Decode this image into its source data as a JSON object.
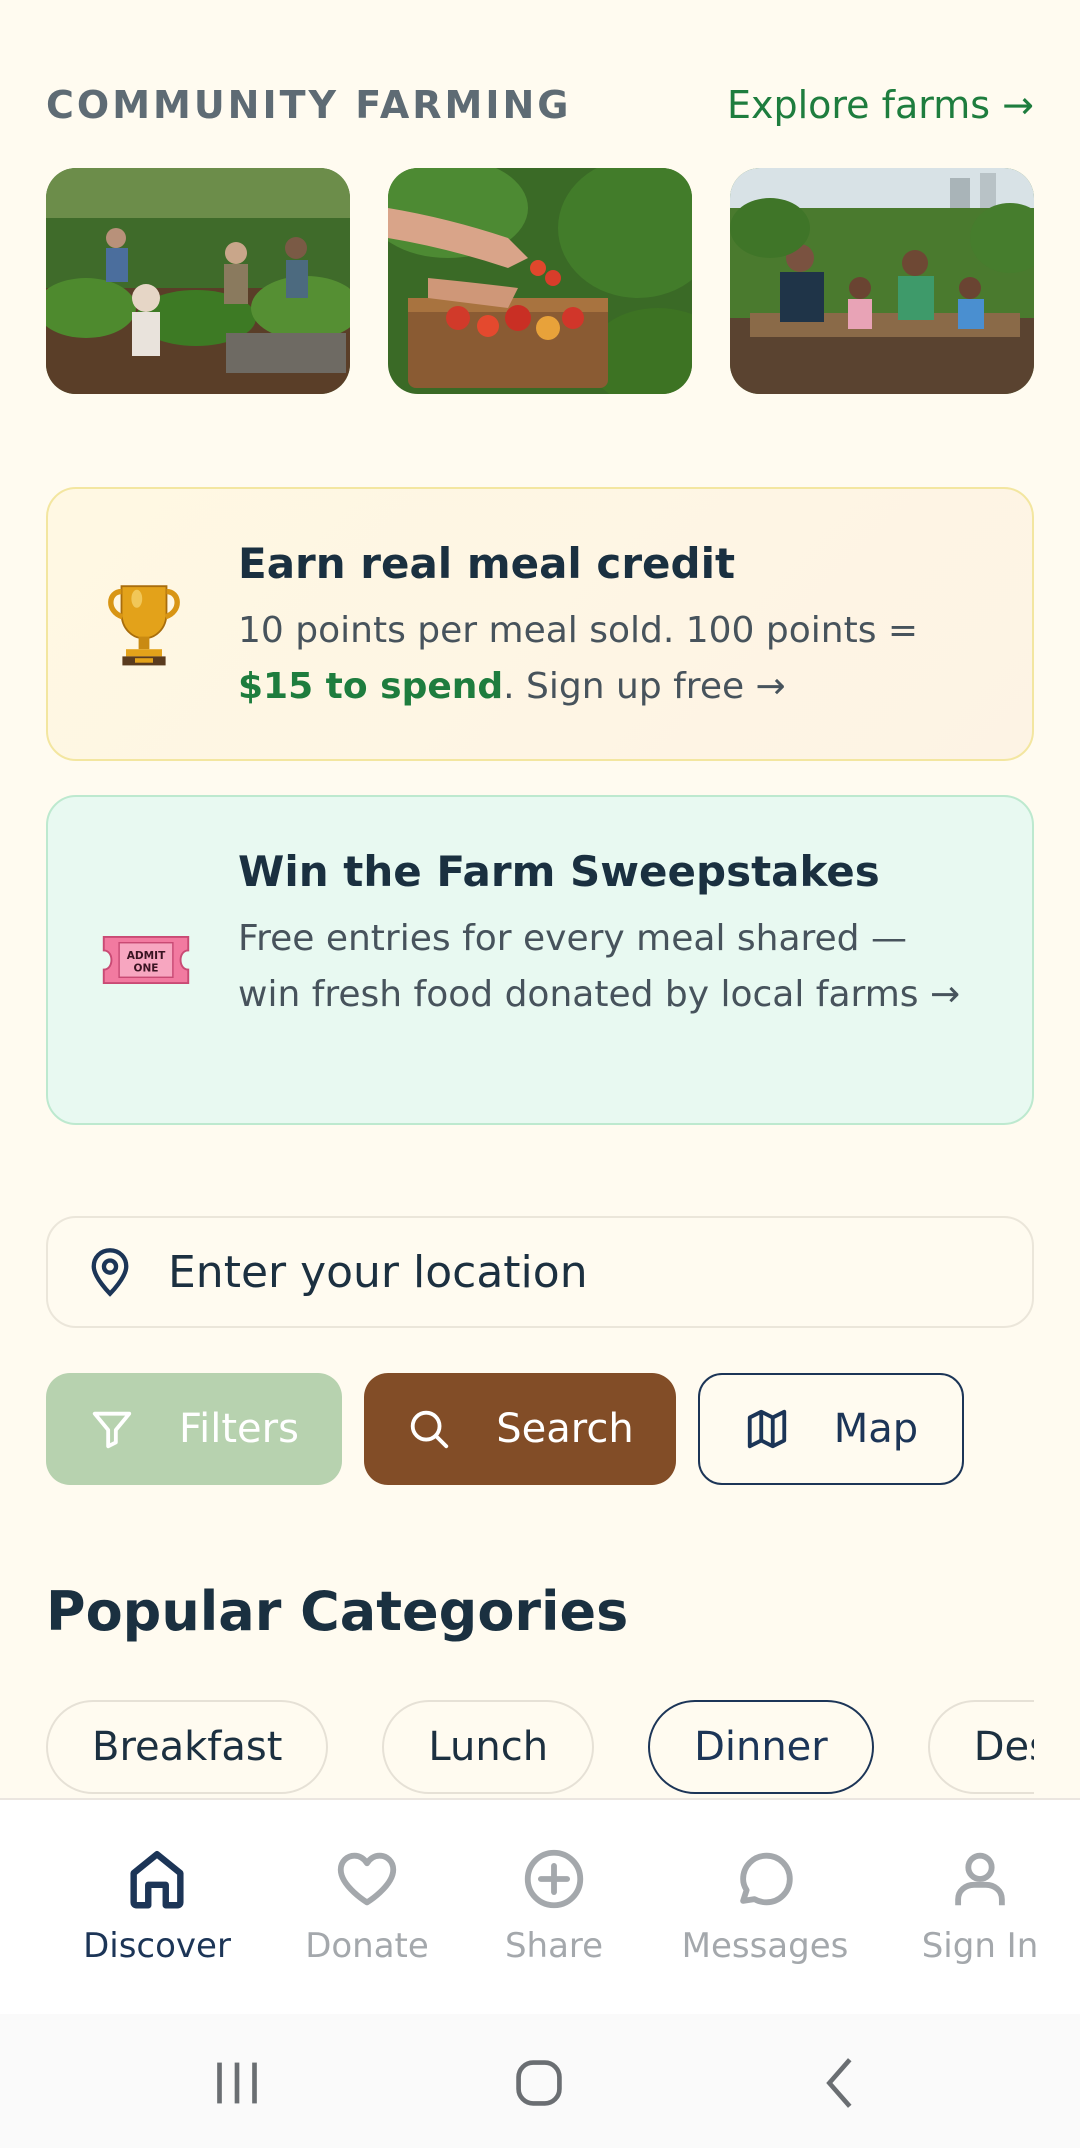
{
  "community": {
    "title": "COMMUNITY FARMING",
    "explore_link": "Explore farms →"
  },
  "promos": {
    "credit": {
      "icon": "trophy-icon",
      "title": "Earn real meal credit",
      "body_prefix": "10 points per meal sold. 100 points = ",
      "body_highlight": "$15 to spend",
      "body_suffix": ". Sign up free →"
    },
    "sweepstakes": {
      "icon": "admit-one-ticket-icon",
      "ticket_text_line1": "ADMIT",
      "ticket_text_line2": "ONE",
      "title": "Win the Farm Sweepstakes",
      "body": "Free entries for every meal shared — win fresh food donated by local farms →"
    }
  },
  "location": {
    "placeholder": "Enter your location",
    "icon": "map-pin-icon"
  },
  "actions": {
    "filters_label": "Filters",
    "search_label": "Search",
    "map_label": "Map"
  },
  "categories": {
    "title": "Popular Categories",
    "items": [
      "Breakfast",
      "Lunch",
      "Dinner",
      "Dessert"
    ],
    "active": "Dinner"
  },
  "nav": {
    "items": [
      {
        "label": "Discover",
        "icon": "home-icon",
        "active": true
      },
      {
        "label": "Donate",
        "icon": "heart-icon",
        "active": false
      },
      {
        "label": "Share",
        "icon": "plus-circle-icon",
        "active": false
      },
      {
        "label": "Messages",
        "icon": "message-bubble-icon",
        "active": false
      },
      {
        "label": "Sign In",
        "icon": "user-icon",
        "active": false
      }
    ]
  },
  "colors": {
    "background": "#fffbf0",
    "accent_green": "#1e7d3e",
    "navy": "#1c3557",
    "search_brown": "#824d27",
    "filters_green": "#b7d2af"
  }
}
